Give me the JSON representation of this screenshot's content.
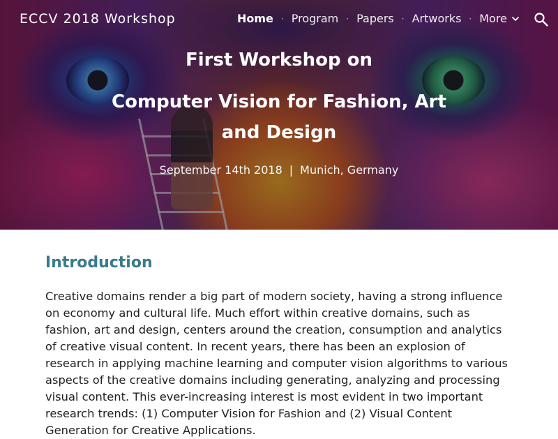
{
  "header": {
    "site_title": "ECCV 2018 Workshop",
    "nav": {
      "home": "Home",
      "program": "Program",
      "papers": "Papers",
      "artworks": "Artworks",
      "more": "More",
      "separator": "·"
    },
    "icons": {
      "more": "chevron-down-icon",
      "search": "search-icon"
    }
  },
  "hero": {
    "line1": "First Workshop on",
    "line2": "Computer Vision for Fashion, Art and Design",
    "date": "September 14th 2018",
    "separator": "|",
    "location": "Munich, Germany"
  },
  "main": {
    "section_title": "Introduction",
    "paragraph": "Creative domains render a big part of modern society, having a strong influence on economy and cultural life. Much effort within creative domains, such as fashion, art and design, centers around the creation, consumption and analytics of creative visual content. In recent years, there has been an explosion of research in applying machine learning and computer vision algorithms to various aspects of the creative domains including generating, analyzing and processing visual content. This ever-increasing interest is most evident in two important research trends: (1) Computer Vision for Fashion and (2) Visual Content Generation for Creative Applications."
  },
  "colors": {
    "section_title": "#3a7a8c",
    "body_text": "#212121",
    "nav_text": "#ffffff"
  }
}
